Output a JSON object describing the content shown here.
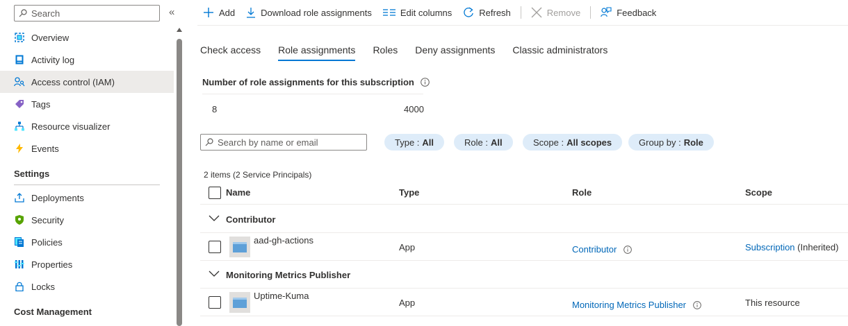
{
  "sidebar": {
    "search_placeholder": "Search",
    "collapse_glyph": "«",
    "items": [
      {
        "label": "Overview",
        "icon": "overview-icon"
      },
      {
        "label": "Activity log",
        "icon": "activity-log-icon"
      },
      {
        "label": "Access control (IAM)",
        "icon": "iam-icon",
        "active": true
      },
      {
        "label": "Tags",
        "icon": "tag-icon"
      },
      {
        "label": "Resource visualizer",
        "icon": "resource-visualizer-icon"
      },
      {
        "label": "Events",
        "icon": "lightning-icon"
      }
    ],
    "settings_header": "Settings",
    "settings_items": [
      {
        "label": "Deployments",
        "icon": "deployments-icon"
      },
      {
        "label": "Security",
        "icon": "shield-icon"
      },
      {
        "label": "Policies",
        "icon": "policies-icon"
      },
      {
        "label": "Properties",
        "icon": "properties-icon"
      },
      {
        "label": "Locks",
        "icon": "lock-icon"
      }
    ],
    "cost_header": "Cost Management"
  },
  "toolbar": {
    "add": "Add",
    "download": "Download role assignments",
    "edit_columns": "Edit columns",
    "refresh": "Refresh",
    "remove": "Remove",
    "feedback": "Feedback"
  },
  "tabs": [
    {
      "label": "Check access"
    },
    {
      "label": "Role assignments",
      "active": true
    },
    {
      "label": "Roles"
    },
    {
      "label": "Deny assignments"
    },
    {
      "label": "Classic administrators"
    }
  ],
  "count": {
    "title": "Number of role assignments for this subscription",
    "current": "8",
    "max": "4000"
  },
  "filters": {
    "search_placeholder": "Search by name or email",
    "type_label": "Type :",
    "type_value": "All",
    "role_label": "Role :",
    "role_value": "All",
    "scope_label": "Scope :",
    "scope_value": "All scopes",
    "group_label": "Group by :",
    "group_value": "Role"
  },
  "grid": {
    "items_summary": "2 items (2 Service Principals)",
    "headers": {
      "name": "Name",
      "type": "Type",
      "role": "Role",
      "scope": "Scope"
    },
    "groups": [
      {
        "label": "Contributor",
        "rows": [
          {
            "name": "aad-gh-actions",
            "type": "App",
            "role": "Contributor",
            "scope_link": "Subscription",
            "scope_suffix": "(Inherited)"
          }
        ]
      },
      {
        "label": "Monitoring Metrics Publisher",
        "rows": [
          {
            "name": "Uptime-Kuma",
            "type": "App",
            "role": "Monitoring Metrics Publisher",
            "scope_text": "This resource"
          }
        ]
      }
    ]
  },
  "colors": {
    "accent": "#0078d4",
    "link": "#0067b8",
    "pill_bg": "#deecf9",
    "active_nav_bg": "#edebe9"
  }
}
